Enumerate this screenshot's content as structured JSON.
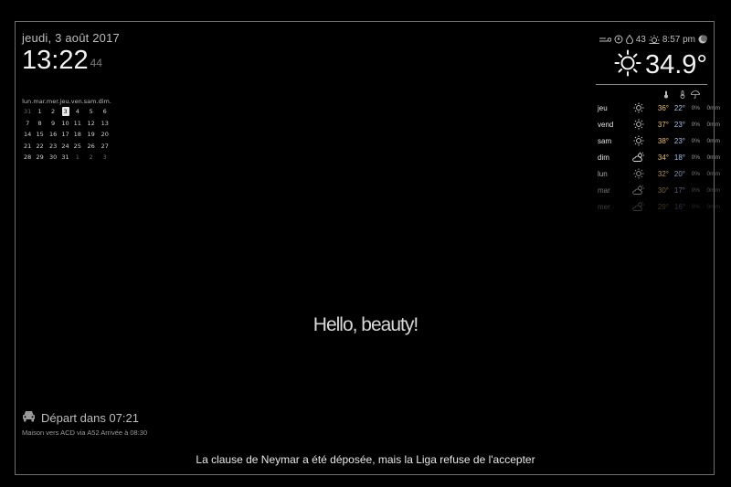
{
  "clock": {
    "date": "jeudi, 3 août 2017",
    "time": "13:22",
    "seconds": "44"
  },
  "calendar": {
    "headers": [
      "lun.",
      "mar.",
      "mer.",
      "jeu.",
      "ven.",
      "sam.",
      "dim."
    ],
    "weeks": [
      [
        "31",
        "1",
        "2",
        "3",
        "4",
        "5",
        "6"
      ],
      [
        "7",
        "8",
        "9",
        "10",
        "11",
        "12",
        "13"
      ],
      [
        "14",
        "15",
        "16",
        "17",
        "18",
        "19",
        "20"
      ],
      [
        "21",
        "22",
        "23",
        "24",
        "25",
        "26",
        "27"
      ],
      [
        "28",
        "29",
        "30",
        "31",
        "1",
        "2",
        "3"
      ]
    ],
    "today": "3"
  },
  "weather": {
    "wind_speed": "43",
    "sunset": "8:57 pm",
    "temperature": "34.9°",
    "forecast": [
      {
        "day": "jeu",
        "icon": "sun-icon",
        "high": "36°",
        "low": "22°",
        "pop": "0%",
        "rain": "0mm"
      },
      {
        "day": "vend",
        "icon": "sun-icon",
        "high": "37°",
        "low": "23°",
        "pop": "0%",
        "rain": "0mm"
      },
      {
        "day": "sam",
        "icon": "sun-icon",
        "high": "38°",
        "low": "23°",
        "pop": "0%",
        "rain": "0mm"
      },
      {
        "day": "dim",
        "icon": "partly-cloudy-icon",
        "high": "34°",
        "low": "18°",
        "pop": "0%",
        "rain": "0mm"
      },
      {
        "day": "lun",
        "icon": "sun-icon",
        "high": "32°",
        "low": "20°",
        "pop": "0%",
        "rain": "0mm"
      },
      {
        "day": "mar",
        "icon": "partly-cloudy-icon",
        "high": "30°",
        "low": "17°",
        "pop": "0%",
        "rain": "0mm"
      },
      {
        "day": "mer",
        "icon": "partly-cloudy-icon",
        "high": "29°",
        "low": "16°",
        "pop": "0%",
        "rain": "0mm"
      }
    ]
  },
  "compliment": "Hello, beauty!",
  "commute": {
    "title": "Départ dans 07:21",
    "details": "Maison vers ACD via A52 Arrivée à 08:30"
  },
  "news": "La clause de Neymar a été déposée, mais la Liga refuse de l'accepter",
  "colors": {
    "background": "#000000",
    "high_temp": "#f0c040",
    "low_temp": "#9fc2ea"
  }
}
